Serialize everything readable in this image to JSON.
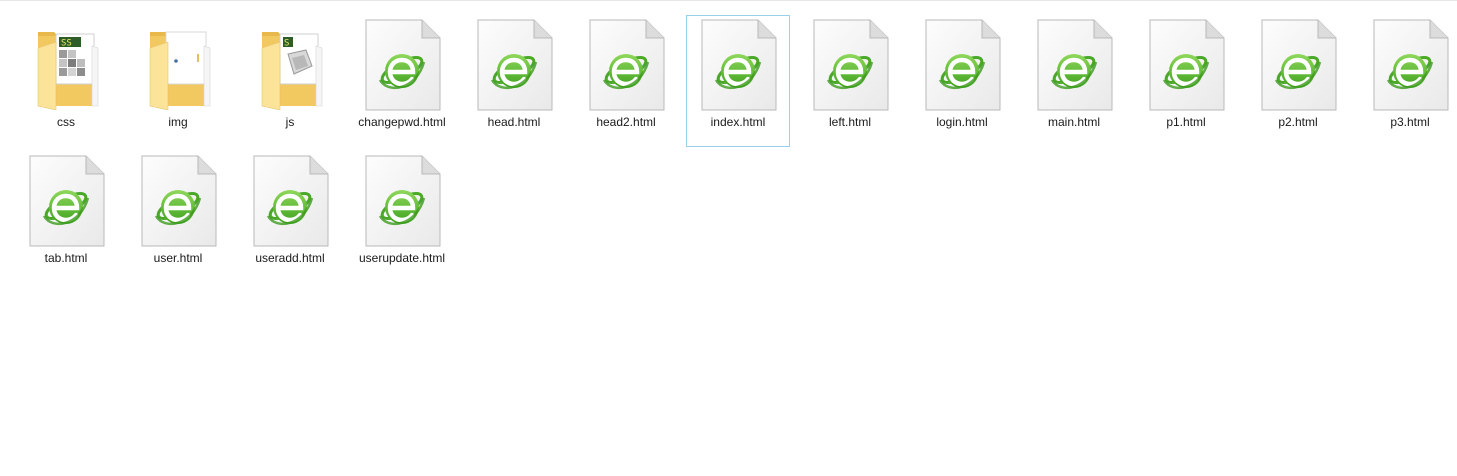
{
  "items": [
    {
      "name": "css",
      "type": "folder",
      "variant": "css",
      "selected": false
    },
    {
      "name": "img",
      "type": "folder",
      "variant": "img",
      "selected": false
    },
    {
      "name": "js",
      "type": "folder",
      "variant": "js",
      "selected": false
    },
    {
      "name": "changepwd.html",
      "type": "html",
      "selected": false
    },
    {
      "name": "head.html",
      "type": "html",
      "selected": false
    },
    {
      "name": "head2.html",
      "type": "html",
      "selected": false
    },
    {
      "name": "index.html",
      "type": "html",
      "selected": true
    },
    {
      "name": "left.html",
      "type": "html",
      "selected": false
    },
    {
      "name": "login.html",
      "type": "html",
      "selected": false
    },
    {
      "name": "main.html",
      "type": "html",
      "selected": false
    },
    {
      "name": "p1.html",
      "type": "html",
      "selected": false
    },
    {
      "name": "p2.html",
      "type": "html",
      "selected": false
    },
    {
      "name": "p3.html",
      "type": "html",
      "selected": false
    },
    {
      "name": "tab.html",
      "type": "html",
      "selected": false
    },
    {
      "name": "user.html",
      "type": "html",
      "selected": false
    },
    {
      "name": "useradd.html",
      "type": "html",
      "selected": false
    },
    {
      "name": "userupdate.html",
      "type": "html",
      "selected": false
    }
  ],
  "icons": {
    "folder": "folder-icon",
    "html": "html-file-icon"
  },
  "colors": {
    "folder_back": "#f2c861",
    "folder_front": "#fbe39a",
    "browser_green": "#5cb82e",
    "selection_border": "#99d1ea",
    "label_text": "#1a1a1a"
  }
}
